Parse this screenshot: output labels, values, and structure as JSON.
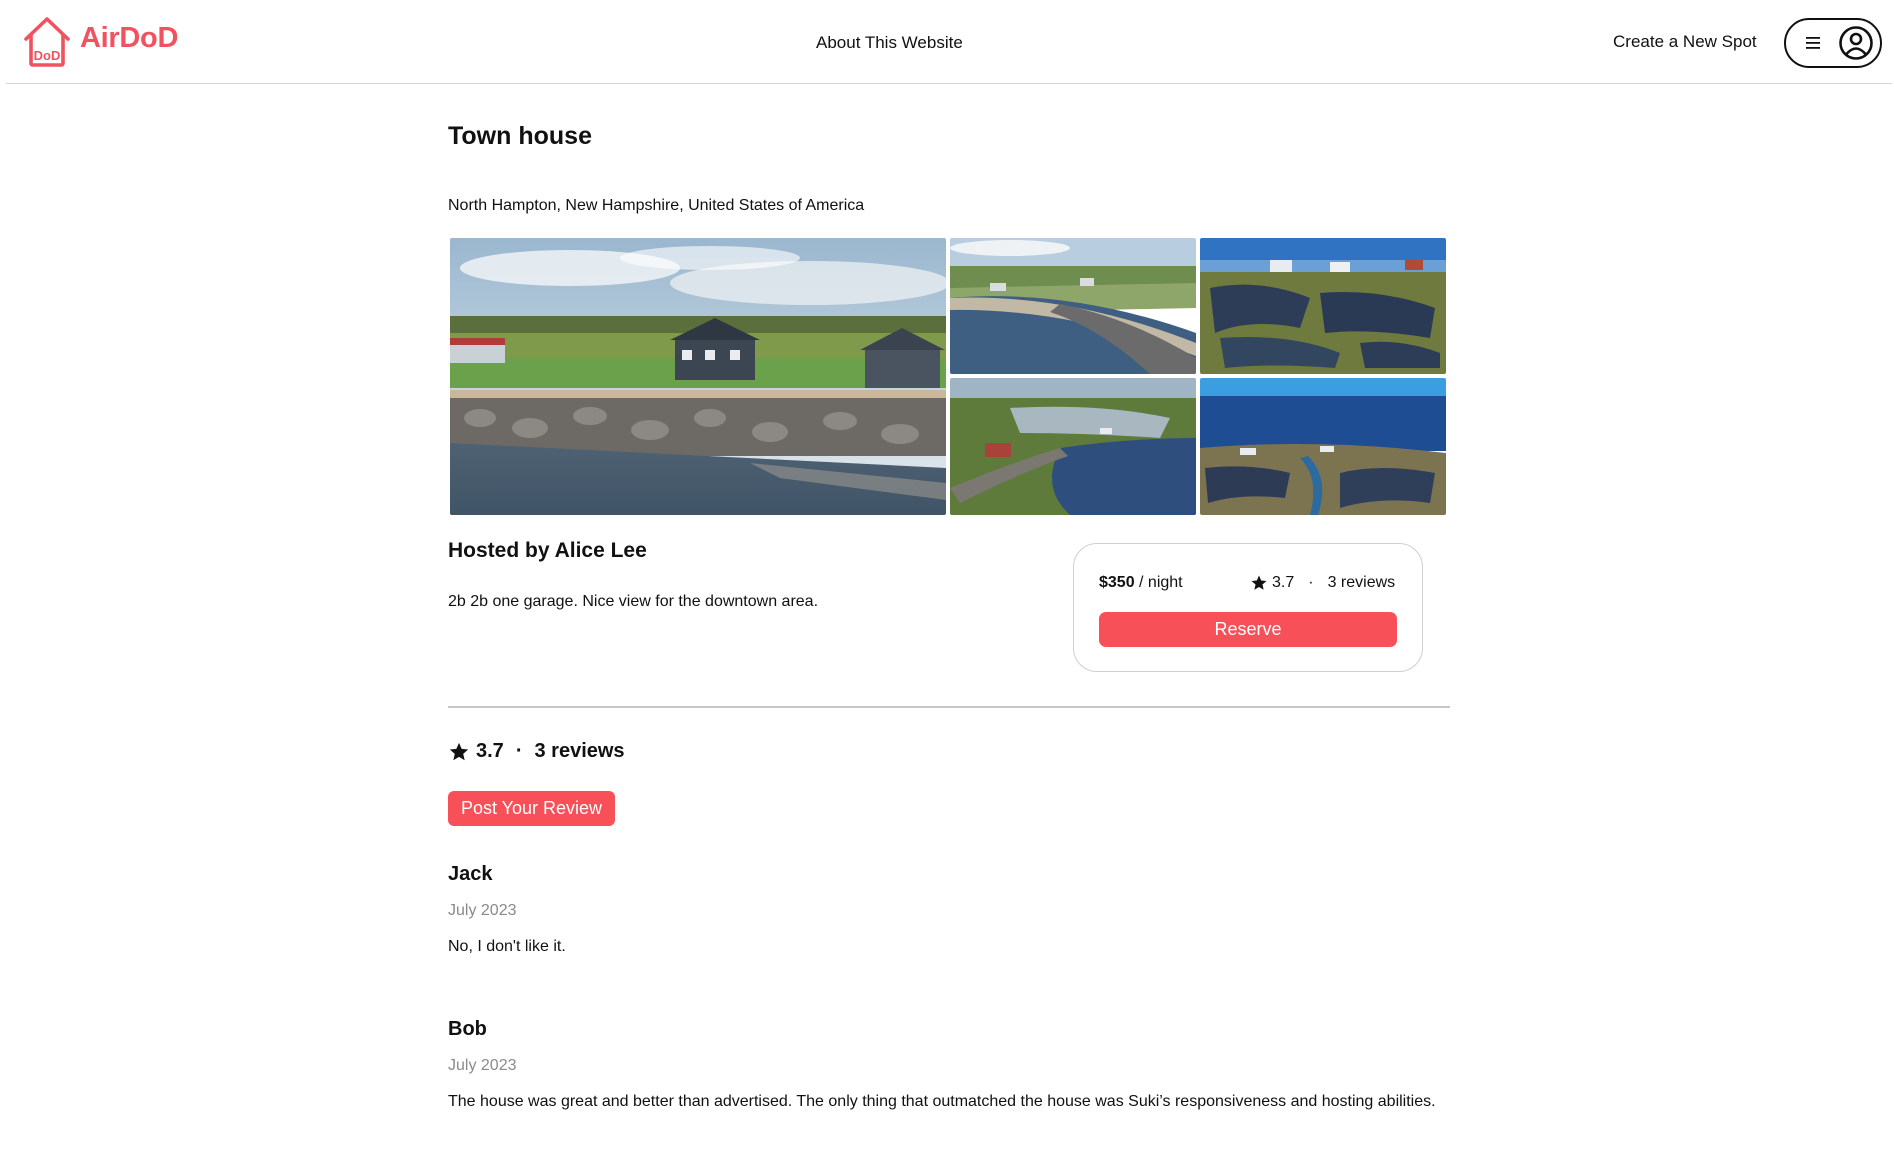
{
  "header": {
    "brand": "AirDoD",
    "logo_mark": "DoD",
    "about_link": "About This Website",
    "create_link": "Create a New Spot",
    "menu_icon": "hamburger-menu-icon",
    "profile_icon": "user-circle-icon"
  },
  "colors": {
    "brand": "#f0525f",
    "accent_button": "#f85059",
    "muted_text": "#8a8a8a"
  },
  "spot": {
    "title": "Town house",
    "location": "North Hampton, New Hampshire, United States of America",
    "host": "Hosted by Alice Lee",
    "description": "2b 2b one garage. Nice view for the downtown area.",
    "images": [
      "aerial-coastal-houses-seawall",
      "aerial-beach-cove",
      "aerial-salt-marsh-ocean",
      "aerial-harbor-neighborhood",
      "aerial-ocean-marsh-houses"
    ]
  },
  "booking": {
    "price": "$350",
    "per": " / night",
    "rating": "3.7",
    "separator": "·",
    "reviews": "3 reviews",
    "reserve_label": "Reserve"
  },
  "reviews_section": {
    "rating": "3.7",
    "separator": "·",
    "count_label": "3 reviews",
    "post_label": "Post Your Review",
    "items": [
      {
        "author": "Jack",
        "date": "July 2023",
        "text": "No, I don't like it."
      },
      {
        "author": "Bob",
        "date": "July 2023",
        "text": "The house was great and better than advertised. The only thing that outmatched the house was Suki’s responsiveness and hosting abilities."
      }
    ]
  }
}
